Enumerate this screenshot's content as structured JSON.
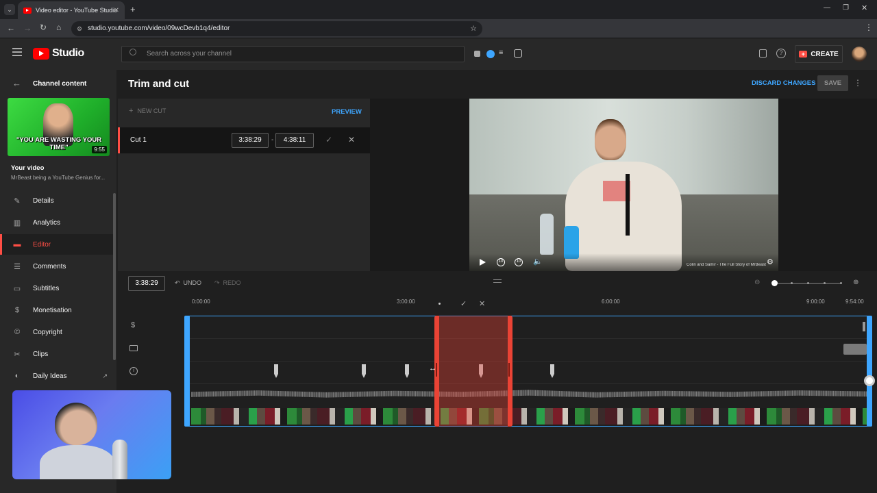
{
  "browser": {
    "tab_title": "Video editor - YouTube Studio",
    "url": "studio.youtube.com/video/09wcDevb1q4/editor"
  },
  "header": {
    "logo_text": "Studio",
    "search_placeholder": "Search across your channel",
    "create_label": "CREATE"
  },
  "sidebar": {
    "back_label": "Channel content",
    "thumb_caption": "\"YOU ARE WASTING YOUR TIME\"",
    "thumb_duration": "9:55",
    "video_heading": "Your video",
    "video_title": "MrBeast being a YouTube Genius for...",
    "items": [
      {
        "label": "Details",
        "icon": "pencil-icon"
      },
      {
        "label": "Analytics",
        "icon": "analytics-icon"
      },
      {
        "label": "Editor",
        "icon": "editor-icon",
        "active": true
      },
      {
        "label": "Comments",
        "icon": "comments-icon"
      },
      {
        "label": "Subtitles",
        "icon": "subtitles-icon"
      },
      {
        "label": "Monetisation",
        "icon": "dollar-icon"
      },
      {
        "label": "Copyright",
        "icon": "copyright-icon"
      },
      {
        "label": "Clips",
        "icon": "scissors-icon"
      },
      {
        "label": "Daily Ideas",
        "icon": "ideas-icon"
      }
    ]
  },
  "editor": {
    "title": "Trim and cut",
    "discard_label": "DISCARD CHANGES",
    "save_label": "SAVE",
    "new_cut_label": "NEW CUT",
    "preview_label": "PREVIEW",
    "cut_name": "Cut 1",
    "cut_start": "3:38:29",
    "cut_end": "4:38:11",
    "cut_separator": "-",
    "video_overlay_caption": "Colin and Samir - The Full Story of MrBeast"
  },
  "timeline": {
    "current_time": "3:38:29",
    "undo_label": "UNDO",
    "redo_label": "REDO",
    "ticks": [
      "0:00:00",
      "3:00:00",
      "6:00:00",
      "9:00:00",
      "9:54:00"
    ],
    "zoom_level": 0
  },
  "colors": {
    "accent_red": "#ff4e45",
    "accent_blue": "#3ea6ff",
    "cut_region": "#ea4335"
  }
}
